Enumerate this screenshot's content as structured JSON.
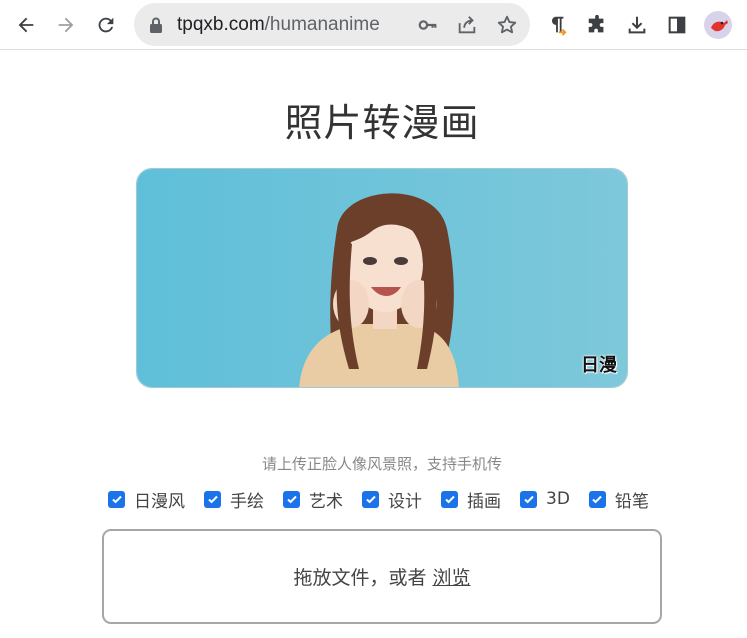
{
  "browser": {
    "url_domain": "tpqxb.com",
    "url_path": "/humananime",
    "icons": [
      "back-icon",
      "forward-icon",
      "reload-icon",
      "lock-icon",
      "key-icon",
      "share-icon",
      "star-icon",
      "pilcrow-extension-icon",
      "puzzle-icon",
      "download-icon",
      "sidepanel-icon",
      "profile-avatar"
    ]
  },
  "page": {
    "title": "照片转漫画",
    "banner_stamp": "日漫",
    "hint": "请上传正脸人像风景照，支持手机传",
    "styles": [
      {
        "label": "日漫风",
        "checked": true
      },
      {
        "label": "手绘",
        "checked": true
      },
      {
        "label": "艺术",
        "checked": true
      },
      {
        "label": "设计",
        "checked": true
      },
      {
        "label": "插画",
        "checked": true
      },
      {
        "label": "3D",
        "checked": true
      },
      {
        "label": "铅笔",
        "checked": true
      }
    ],
    "dropzone": {
      "text": "拖放文件，或者",
      "browse": "浏览"
    }
  },
  "colors": {
    "accent": "#1a73e8",
    "banner_bg": "#6ec3da"
  }
}
